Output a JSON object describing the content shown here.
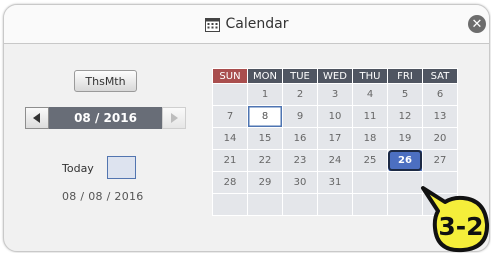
{
  "dialog": {
    "title": "Calendar",
    "close_icon": "close-icon"
  },
  "controls": {
    "thsmth_label": "ThsMth",
    "month_year": "08 / 2016",
    "today_label": "Today",
    "today_date": "08 / 08 / 2016"
  },
  "calendar": {
    "weekdays": [
      "SUN",
      "MON",
      "TUE",
      "WED",
      "THU",
      "FRI",
      "SAT"
    ],
    "weeks": [
      [
        "",
        "1",
        "2",
        "3",
        "4",
        "5",
        "6"
      ],
      [
        "7",
        "8",
        "9",
        "10",
        "11",
        "12",
        "13"
      ],
      [
        "14",
        "15",
        "16",
        "17",
        "18",
        "19",
        "20"
      ],
      [
        "21",
        "22",
        "23",
        "24",
        "25",
        "26",
        "27"
      ],
      [
        "28",
        "29",
        "30",
        "31",
        "",
        "",
        ""
      ],
      [
        "",
        "",
        "",
        "",
        "",
        "",
        ""
      ]
    ],
    "today_day": "8",
    "selected_day": "26"
  },
  "callout": {
    "label": "3-2"
  },
  "colors": {
    "header_bg": "#4f5561",
    "sunday_header_bg": "#a94e4e",
    "selected_bg": "#4c6fc1",
    "today_border": "#4e74b2",
    "callout_fill": "#f5ee3a"
  }
}
